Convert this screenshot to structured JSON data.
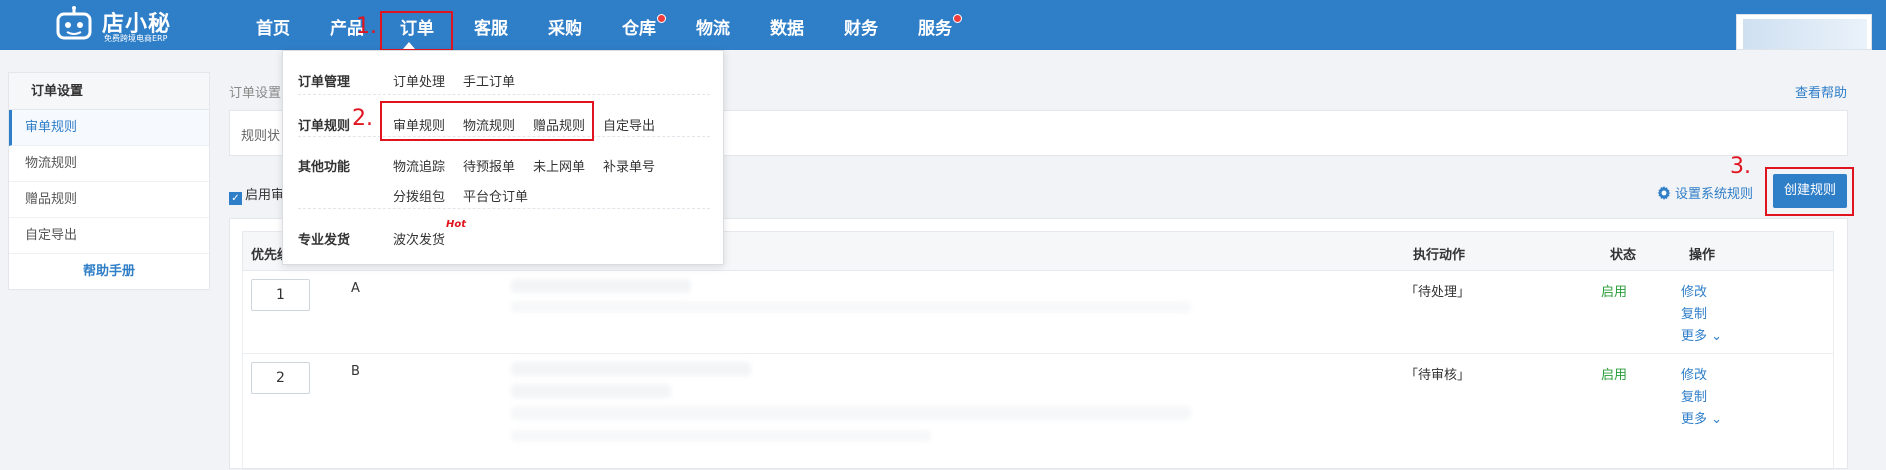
{
  "header": {
    "brand": "店小秘",
    "brand_sub": "免费跨境电商ERP",
    "nav": [
      {
        "label": "首页"
      },
      {
        "label": "产品"
      },
      {
        "label": "订单"
      },
      {
        "label": "客服"
      },
      {
        "label": "采购"
      },
      {
        "label": "仓库"
      },
      {
        "label": "物流"
      },
      {
        "label": "数据"
      },
      {
        "label": "财务"
      },
      {
        "label": "服务"
      }
    ],
    "accent_color": "#2f7ec8"
  },
  "annotations": {
    "step1": "1.",
    "step2": "2.",
    "step3": "3."
  },
  "dropdown": {
    "groups": [
      {
        "title": "订单管理",
        "links": [
          "订单处理",
          "手工订单"
        ]
      },
      {
        "title": "订单规则",
        "links": [
          "审单规则",
          "物流规则",
          "赠品规则",
          "自定导出"
        ]
      },
      {
        "title": "其他功能",
        "links": [
          "物流追踪",
          "待预报单",
          "未上网单",
          "补录单号",
          "分拨组包",
          "平台仓订单"
        ]
      },
      {
        "title": "专业发货",
        "links": [
          "波次发货"
        ],
        "badge": "Hot"
      }
    ]
  },
  "sidebar": {
    "title": "订单设置",
    "items": [
      {
        "label": "审单规则"
      },
      {
        "label": "物流规则"
      },
      {
        "label": "赠品规则"
      },
      {
        "label": "自定导出"
      }
    ],
    "help": "帮助手册"
  },
  "main": {
    "breadcrumb": "订单设置",
    "help_link": "查看帮助",
    "status_label": "规则状",
    "enable_label": "启用审",
    "sys_rule_label": "设置系统规则",
    "create_button": "创建规则",
    "table": {
      "headers": {
        "priority": "优先级",
        "action": "执行动作",
        "status": "状态",
        "ops": "操作"
      },
      "rows": [
        {
          "priority": "1",
          "name": "A",
          "action": "「待处理」",
          "status": "启用",
          "ops": [
            "修改",
            "复制",
            "更多"
          ]
        },
        {
          "priority": "2",
          "name": "B",
          "action": "「待审核」",
          "status": "启用",
          "ops": [
            "修改",
            "复制",
            "更多"
          ]
        }
      ]
    }
  }
}
